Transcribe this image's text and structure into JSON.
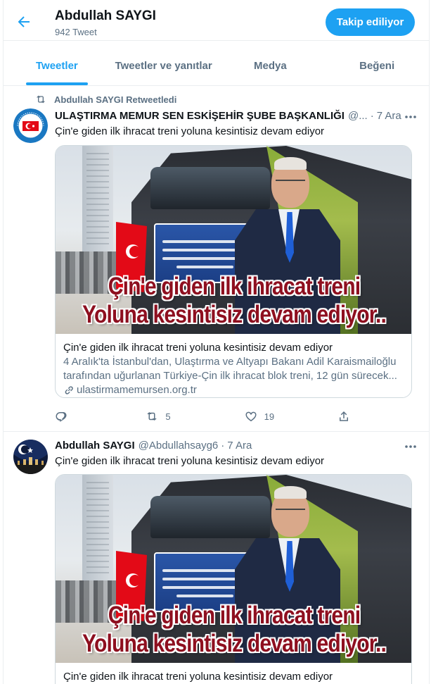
{
  "header": {
    "title": "Abdullah SAYGI",
    "subtitle": "942 Tweet",
    "follow_label": "Takip ediliyor"
  },
  "tabs": [
    {
      "label": "Tweetler",
      "active": true
    },
    {
      "label": "Tweetler ve yanıtlar",
      "active": false
    },
    {
      "label": "Medya",
      "active": false
    },
    {
      "label": "Beğeni",
      "active": false
    }
  ],
  "tweets": [
    {
      "retweet_label": "Abdullah SAYGI Retweetledi",
      "name": "ULAŞTIRMA MEMUR SEN ESKİŞEHİR ŞUBE BAŞKANLIĞI",
      "handle": "@...",
      "dot": "·",
      "time": "7 Ara",
      "text": "Çin'e giden ilk ihracat treni yoluna kesintisiz devam ediyor",
      "image_caption_line1": "Çin'e giden ilk ihracat treni",
      "image_caption_line2": "Yoluna kesintisiz devam ediyor..",
      "card": {
        "title": "Çin'e giden ilk ihracat treni yoluna kesintisiz devam ediyor",
        "description_line1": "4 Aralık'ta İstanbul'dan, Ulaştırma ve Altyapı Bakanı Adil Karaismailoğlu",
        "description_line2": "tarafından uğurlanan Türkiye-Çin ilk ihracat blok treni, 12 gün sürecek...",
        "link": "ulastirmamemursen.org.tr"
      },
      "retweet_count": "5",
      "like_count": "19"
    },
    {
      "name": "Abdullah SAYGI",
      "handle": "@Abdullahsayg6",
      "dot": "·",
      "time": "7 Ara",
      "text": "Çin'e giden ilk ihracat treni yoluna kesintisiz devam ediyor",
      "image_caption_line1": "Çin'e giden ilk ihracat treni",
      "image_caption_line2": "Yoluna kesintisiz devam ediyor..",
      "card": {
        "title": "Çin'e giden ilk ihracat treni yoluna kesintisiz devam ediyor"
      }
    }
  ],
  "colors": {
    "accent": "#1da1f2",
    "secondary_text": "#5b7083",
    "border": "#ebeef0"
  },
  "icons": {
    "back": "arrow-left-icon",
    "retweeted": "retweet-icon",
    "more": "more-horizontal-icon",
    "reply": "reply-icon",
    "retweet": "retweet-icon",
    "like": "heart-icon",
    "share": "share-icon",
    "link": "link-icon"
  }
}
